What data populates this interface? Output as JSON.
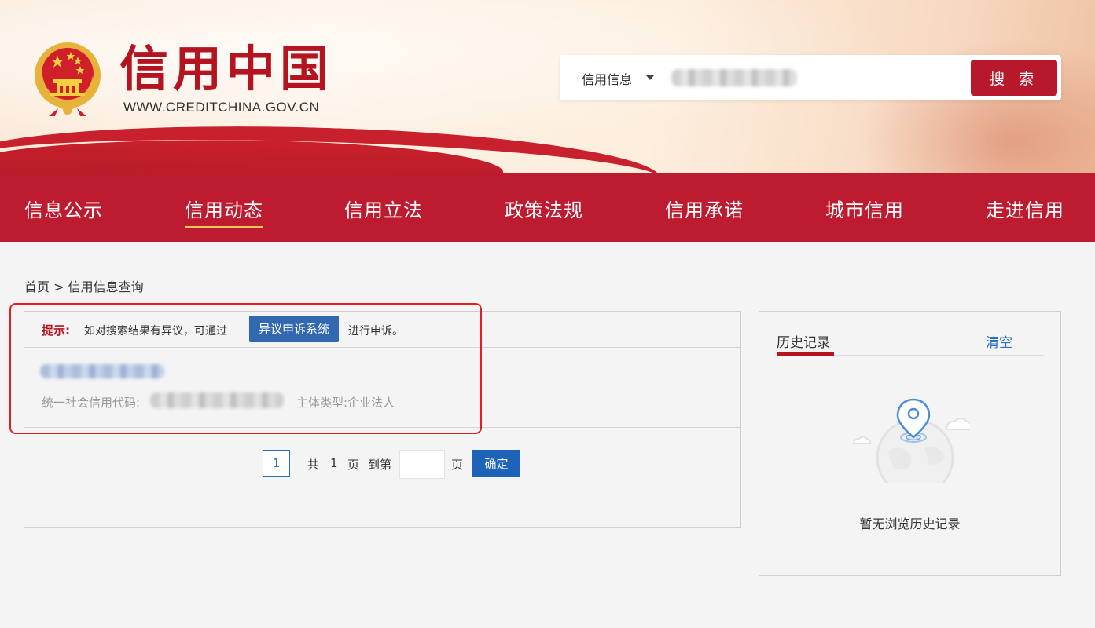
{
  "header": {
    "title": "信用中国",
    "url": "WWW.CREDITCHINA.GOV.CN"
  },
  "search": {
    "scope": "信用信息",
    "button": "搜 索"
  },
  "nav": {
    "items": [
      "信息公示",
      "信用动态",
      "信用立法",
      "政策法规",
      "信用承诺",
      "城市信用",
      "走进信用"
    ],
    "active": "信用动态"
  },
  "breadcrumb": {
    "home": "首页",
    "separator": ">",
    "current": "信用信息查询"
  },
  "tip": {
    "label": "提示:",
    "text": "如对搜索结果有异议，可通过",
    "link": "异议申诉系统",
    "after": "进行申诉。"
  },
  "result": {
    "code_label": "统一社会信用代码:",
    "type_label": "主体类型:",
    "type_value": "企业法人"
  },
  "pager": {
    "current": "1",
    "total_prefix": "共",
    "total": "1",
    "total_suffix": "页",
    "goto_prefix": "到第",
    "goto_suffix": "页",
    "confirm": "确定"
  },
  "history": {
    "title": "历史记录",
    "clear": "清空",
    "empty": "暂无浏览历史记录"
  },
  "colors": {
    "brand_red": "#bd1b2f",
    "nav_underline": "#f2c35b",
    "link_blue": "#2b6fb8"
  }
}
